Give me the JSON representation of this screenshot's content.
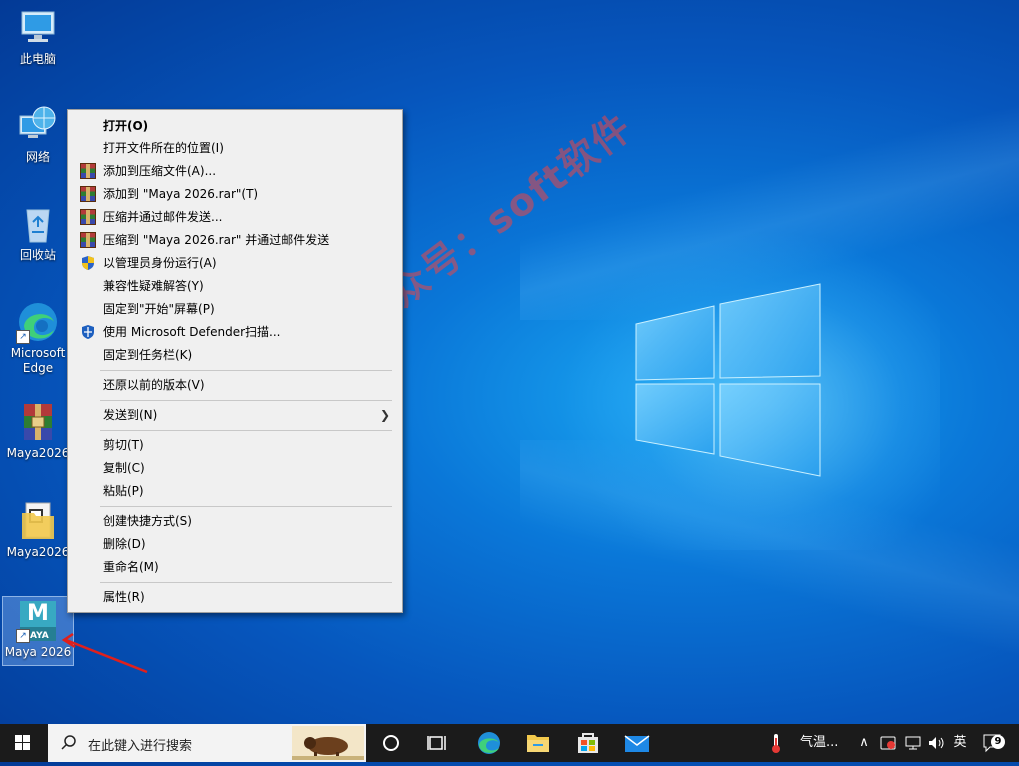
{
  "desktop": {
    "icons": [
      {
        "label": "此电脑"
      },
      {
        "label": "网络"
      },
      {
        "label": "回收站"
      },
      {
        "label": "Microsoft Edge"
      },
      {
        "label": "Maya2026"
      },
      {
        "label": "Maya2026"
      },
      {
        "label": "Maya 2026"
      }
    ],
    "maya_icon_badge": "AYA",
    "maya_icon_letter": "M",
    "watermark": "微信公众号：soft软件"
  },
  "context_menu": {
    "items": [
      {
        "label": "打开(O)",
        "icon": ""
      },
      {
        "label": "打开文件所在的位置(I)",
        "icon": ""
      },
      {
        "label": "添加到压缩文件(A)...",
        "icon": "winrar-icon"
      },
      {
        "label": "添加到 \"Maya 2026.rar\"(T)",
        "icon": "winrar-icon"
      },
      {
        "label": "压缩并通过邮件发送...",
        "icon": "winrar-icon"
      },
      {
        "label": "压缩到 \"Maya 2026.rar\" 并通过邮件发送",
        "icon": "winrar-icon"
      },
      {
        "label": "以管理员身份运行(A)",
        "icon": "uac-shield-icon"
      },
      {
        "label": "兼容性疑难解答(Y)",
        "icon": ""
      },
      {
        "label": "固定到\"开始\"屏幕(P)",
        "icon": ""
      },
      {
        "label": "使用 Microsoft Defender扫描...",
        "icon": "defender-icon"
      },
      {
        "label": "固定到任务栏(K)",
        "icon": ""
      },
      {
        "label": "还原以前的版本(V)",
        "icon": ""
      },
      {
        "label": "发送到(N)",
        "icon": "chevron-right-icon"
      },
      {
        "label": "剪切(T)",
        "icon": ""
      },
      {
        "label": "复制(C)",
        "icon": ""
      },
      {
        "label": "粘贴(P)",
        "icon": ""
      },
      {
        "label": "创建快捷方式(S)",
        "icon": ""
      },
      {
        "label": "删除(D)",
        "icon": ""
      },
      {
        "label": "重命名(M)",
        "icon": ""
      },
      {
        "label": "属性(R)",
        "icon": ""
      }
    ]
  },
  "taskbar": {
    "search_placeholder": "在此键入进行搜索",
    "weather_label": "气温...",
    "ime_label": "英",
    "notification_count": "9"
  },
  "colors": {
    "annotation_arrow": "#e0201c",
    "taskbar_bg": "#1b1b1b",
    "menu_bg": "#f0f0f0"
  }
}
